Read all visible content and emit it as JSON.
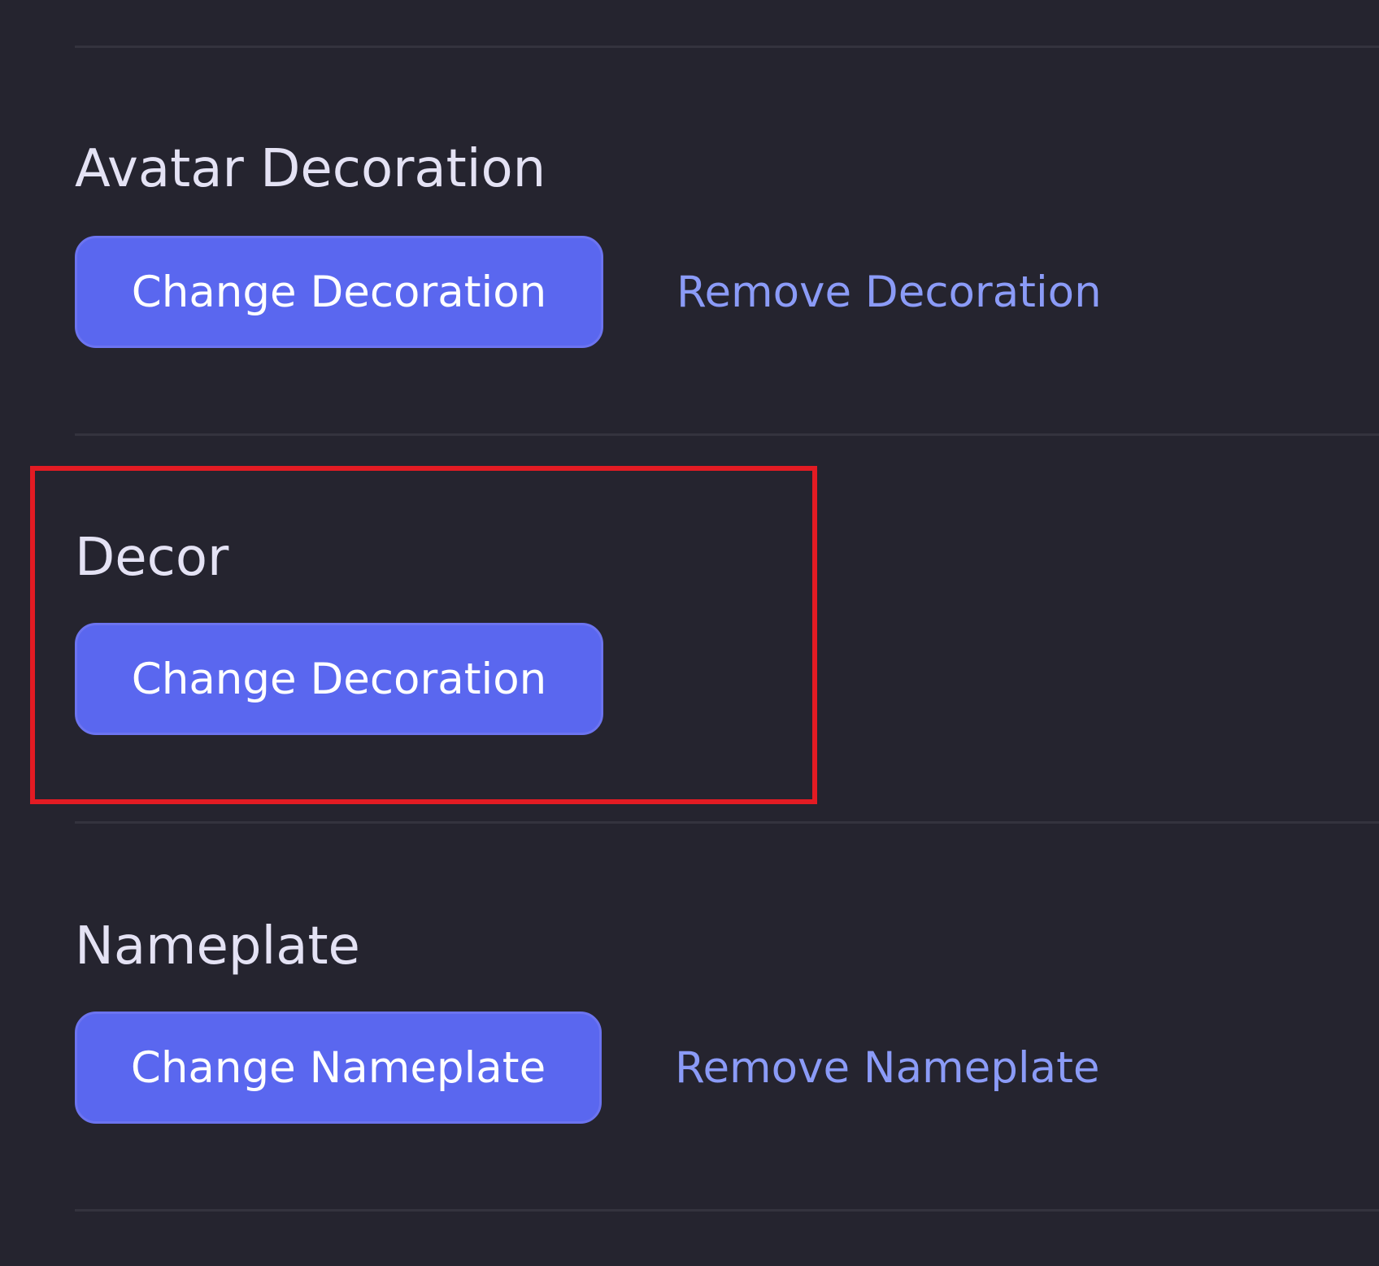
{
  "sections": {
    "avatar_decoration": {
      "title": "Avatar Decoration",
      "primary_button": "Change Decoration",
      "link_button": "Remove Decoration"
    },
    "decor": {
      "title": "Decor",
      "primary_button": "Change Decoration"
    },
    "nameplate": {
      "title": "Nameplate",
      "primary_button": "Change Nameplate",
      "link_button": "Remove Nameplate"
    }
  },
  "colors": {
    "background": "#25242f",
    "divider": "#34333e",
    "heading_text": "#e4e2f4",
    "primary_button": "#5a67ef",
    "link_text": "#8b9bf7",
    "highlight_border": "#e31b23"
  }
}
